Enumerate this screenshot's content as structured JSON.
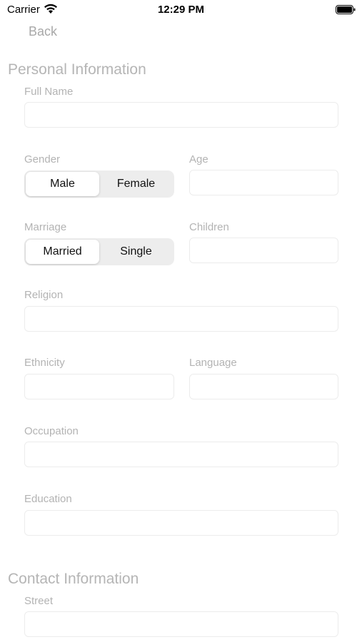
{
  "status_bar": {
    "carrier": "Carrier",
    "time": "12:29 PM",
    "wifi_icon": "wifi-icon",
    "battery_icon": "battery-icon"
  },
  "nav": {
    "back_label": "Back"
  },
  "personal": {
    "title": "Personal Information",
    "full_name": {
      "label": "Full Name",
      "value": ""
    },
    "gender": {
      "label": "Gender",
      "options": [
        "Male",
        "Female"
      ],
      "selected": "Male"
    },
    "age": {
      "label": "Age",
      "value": ""
    },
    "marriage": {
      "label": "Marriage",
      "options": [
        "Married",
        "Single"
      ],
      "selected": "Married"
    },
    "children": {
      "label": "Children",
      "value": ""
    },
    "religion": {
      "label": "Religion",
      "value": ""
    },
    "ethnicity": {
      "label": "Ethnicity",
      "value": ""
    },
    "language": {
      "label": "Language",
      "value": ""
    },
    "occupation": {
      "label": "Occupation",
      "value": ""
    },
    "education": {
      "label": "Education",
      "value": ""
    }
  },
  "contact": {
    "title": "Contact Information",
    "street": {
      "label": "Street",
      "value": ""
    }
  },
  "colors": {
    "label_gray": "#b3b3b3",
    "section_gray": "#b5b5b5",
    "back_gray": "#a8a8a8",
    "segment_bg": "#ededed",
    "field_border": "#ececec"
  }
}
